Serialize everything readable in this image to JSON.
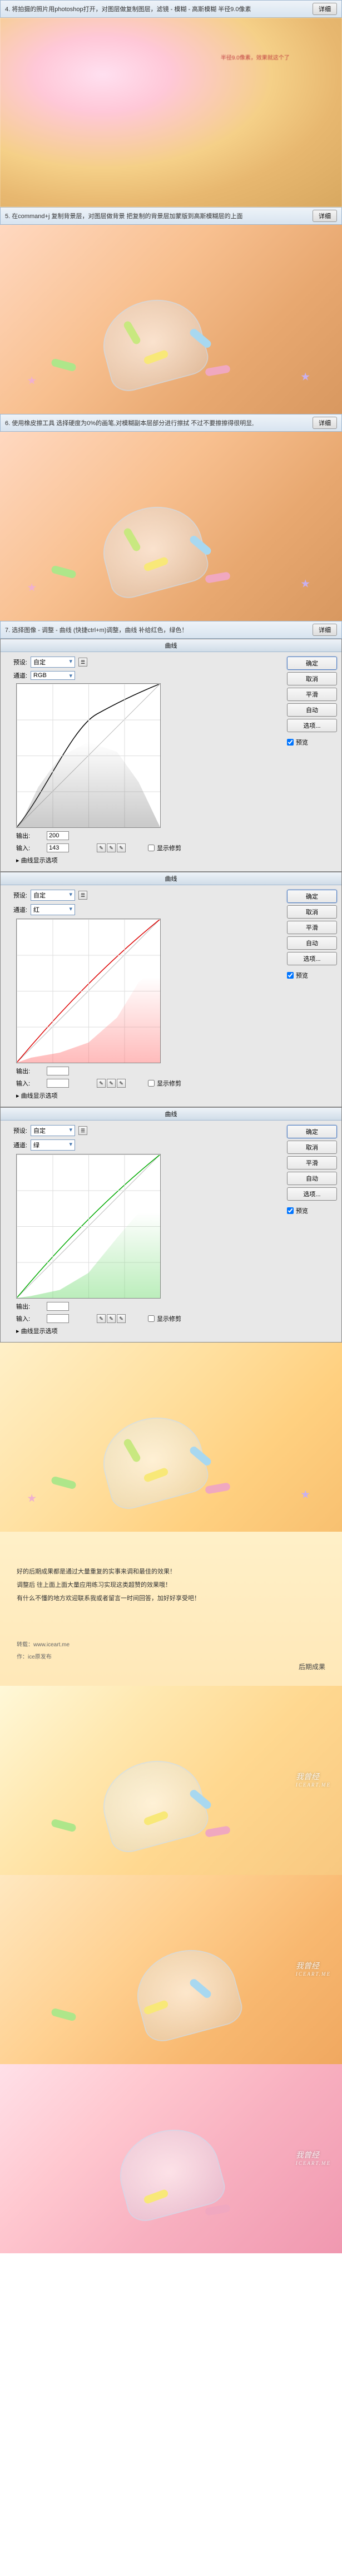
{
  "steps": {
    "s4": {
      "text": "4. 将拍摄的照片用photoshop打开，对图层做复制图层，滤镜 - 模糊 - 高斯模糊 半径9.0像素",
      "btn": "详细"
    },
    "s5": {
      "text": "5. 在command+j 复制背景层，对图层做背景 把复制的背景层加蒙版到高斯模糊层的上面",
      "btn": "详细"
    },
    "s6": {
      "text": "6. 使用橡皮擦工具 选择硬度为0%的画笔,对模糊副本层部分进行擦拭 不过不要擦擦得很明显,",
      "btn": "详细"
    },
    "s7": {
      "text": "7. 选择图像 - 调整 - 曲线 (快捷ctrl+m)调整，曲线 补给红色，绿色！",
      "btn": "详细"
    }
  },
  "annotations": {
    "blur_note": "半径9.0像素，效果就这个了"
  },
  "curves": {
    "title": "曲线",
    "preset_label": "预设:",
    "preset_value": "自定",
    "channel_label": "通道:",
    "channel_rgb": "RGB",
    "channel_red": "红",
    "channel_green": "绿",
    "output_label": "输出:",
    "input_label": "输入:",
    "rgb": {
      "output": "200",
      "input": "143"
    },
    "red": {
      "output": "",
      "input": ""
    },
    "green": {
      "output": "",
      "input": ""
    },
    "show_clipping": "显示修剪",
    "curve_options": "曲线显示选项",
    "buttons": {
      "ok": "确定",
      "cancel": "取消",
      "smooth": "平滑",
      "auto": "自动",
      "options": "选项...",
      "preview": "预览"
    }
  },
  "text_block": {
    "line1": "好的后期成果都是通过大量重复的实事来调和最佳的效果！",
    "line2": "调整后 往上面上面大量应用练习实现这类超赞的效果哦！",
    "line3": "有什么不懂的地方欢迎联系我或者留言一时间回答，加好好享受吧！",
    "credit1": "转载：www.iceart.me",
    "credit2": "作：ice原发布",
    "final": "后期成果"
  },
  "watermark": {
    "main": "我曾经",
    "sub": "ICEART.ME"
  },
  "chart_data": [
    {
      "type": "line",
      "title": "曲线 RGB",
      "xlabel": "输入",
      "ylabel": "输出",
      "xlim": [
        0,
        255
      ],
      "ylim": [
        0,
        255
      ],
      "series": [
        {
          "name": "baseline",
          "x": [
            0,
            255
          ],
          "y": [
            0,
            255
          ]
        },
        {
          "name": "curve",
          "x": [
            0,
            60,
            143,
            210,
            255
          ],
          "y": [
            0,
            90,
            200,
            240,
            255
          ]
        }
      ],
      "control_point": {
        "input": 143,
        "output": 200
      }
    },
    {
      "type": "line",
      "title": "曲线 红",
      "xlabel": "输入",
      "ylabel": "输出",
      "xlim": [
        0,
        255
      ],
      "ylim": [
        0,
        255
      ],
      "series": [
        {
          "name": "baseline",
          "x": [
            0,
            255
          ],
          "y": [
            0,
            255
          ]
        },
        {
          "name": "curve",
          "x": [
            0,
            128,
            255
          ],
          "y": [
            0,
            150,
            255
          ]
        }
      ]
    },
    {
      "type": "line",
      "title": "曲线 绿",
      "xlabel": "输入",
      "ylabel": "输出",
      "xlim": [
        0,
        255
      ],
      "ylim": [
        0,
        255
      ],
      "series": [
        {
          "name": "baseline",
          "x": [
            0,
            255
          ],
          "y": [
            0,
            255
          ]
        },
        {
          "name": "curve",
          "x": [
            0,
            128,
            255
          ],
          "y": [
            0,
            150,
            255
          ]
        }
      ]
    }
  ]
}
